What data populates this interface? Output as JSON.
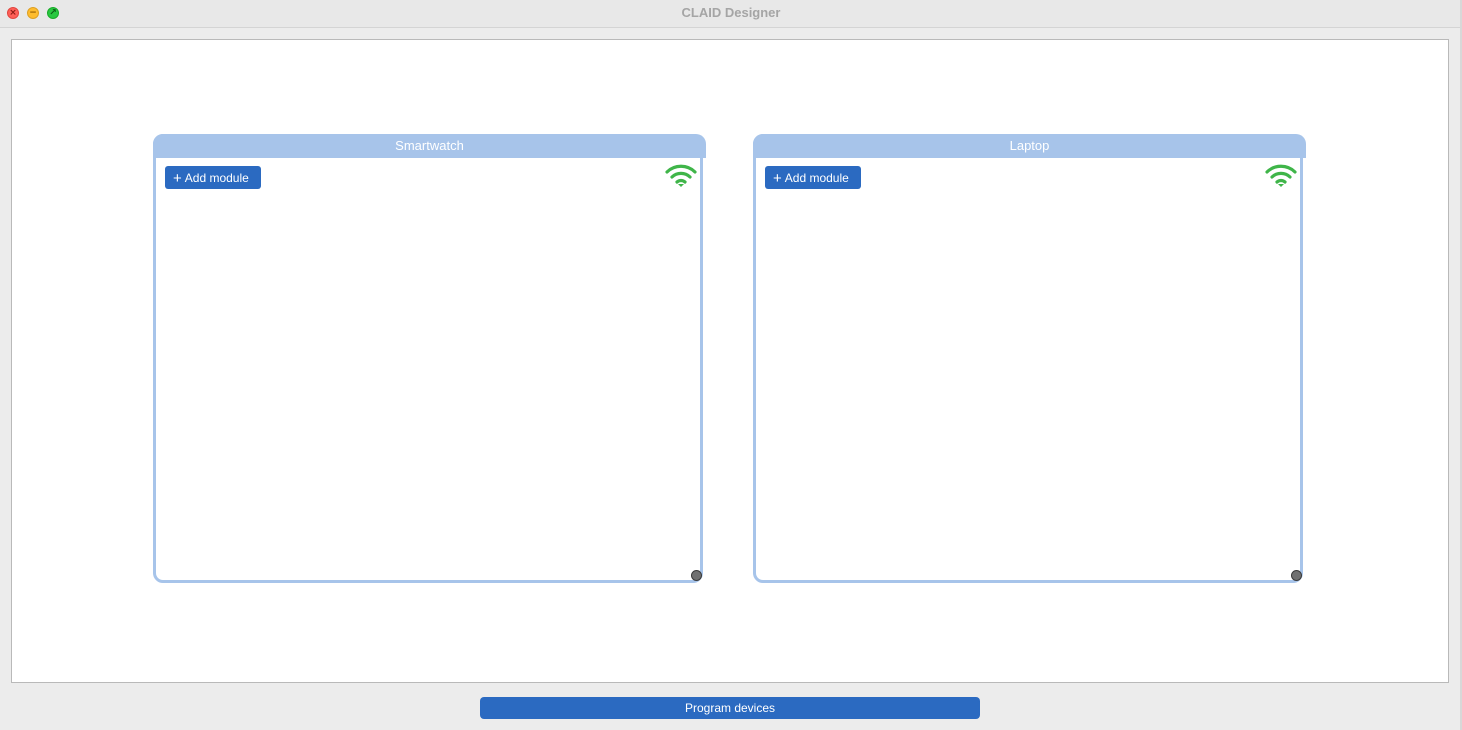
{
  "window": {
    "title": "CLAID Designer",
    "controls": {
      "close_icon": "close-icon",
      "minimize_icon": "minimize-icon",
      "maximize_icon": "fullscreen-icon"
    }
  },
  "devices": [
    {
      "name": "Smartwatch",
      "add_module_label": "Add module",
      "add_icon": "plus-icon",
      "status_icon": "wifi-icon",
      "status_color": "#3fb549"
    },
    {
      "name": "Laptop",
      "add_module_label": "Add module",
      "add_icon": "plus-icon",
      "status_icon": "wifi-icon",
      "status_color": "#3fb549"
    }
  ],
  "footer": {
    "program_label": "Program devices"
  },
  "colors": {
    "accent": "#2b6ac1",
    "device_border": "#a7c4ea"
  }
}
